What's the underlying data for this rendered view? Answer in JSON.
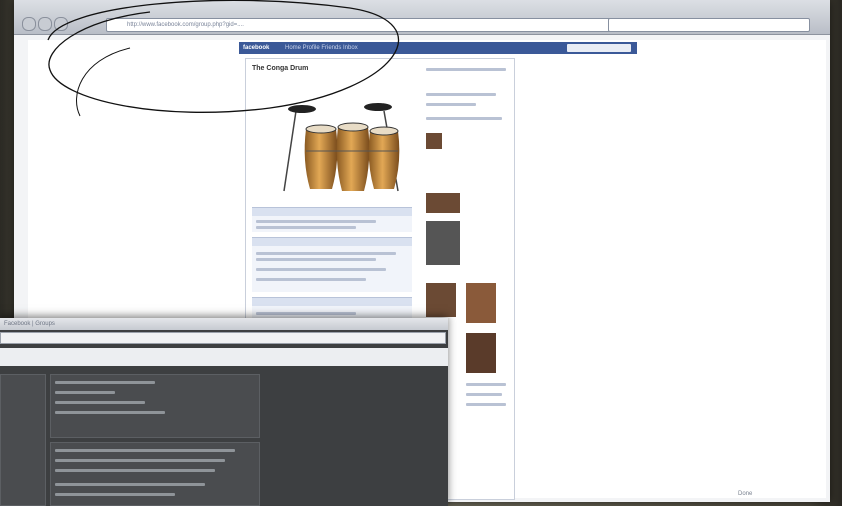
{
  "browser": {
    "url": "http://www.facebook.com/group.php?gid=....",
    "status": "Done"
  },
  "facebook": {
    "logo": "facebook",
    "nav_text": "Home  Profile  Friends  Inbox",
    "page_title": "The Conga Drum"
  },
  "overlay": {
    "title": "Facebook | Groups",
    "address": "",
    "band_label": ""
  },
  "colors": {
    "facebook_blue": "#3b5998",
    "overlay_dark": "#3d3f41",
    "drum_wood": "#c98a3c"
  },
  "icons": {
    "back": "back-icon",
    "forward": "forward-icon",
    "reload": "reload-icon"
  }
}
